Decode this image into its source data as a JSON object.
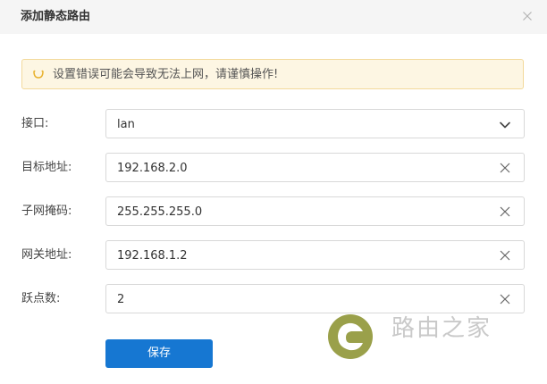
{
  "dialog": {
    "title": "添加静态路由",
    "warning_text": "设置错误可能会导致无法上网，请谨慎操作!"
  },
  "form": {
    "interface": {
      "label": "接口:",
      "value": "lan"
    },
    "target_address": {
      "label": "目标地址:",
      "value": "192.168.2.0"
    },
    "subnet_mask": {
      "label": "子网掩码:",
      "value": "255.255.255.0"
    },
    "gateway": {
      "label": "网关地址:",
      "value": "192.168.1.2"
    },
    "hops": {
      "label": "跃点数:",
      "value": "2"
    }
  },
  "actions": {
    "save_label": "保存"
  },
  "watermark": {
    "text": "路由之家"
  },
  "colors": {
    "primary": "#1677d2",
    "warning_bg": "#fdf6e3",
    "warning_border": "#f3d99b",
    "warning_icon": "#e8b12c",
    "logo": "#9aa04a"
  },
  "icons": {
    "close": "close-icon",
    "warning": "smile-warning-icon",
    "dropdown": "chevron-down-icon",
    "clear": "clear-x-icon"
  }
}
